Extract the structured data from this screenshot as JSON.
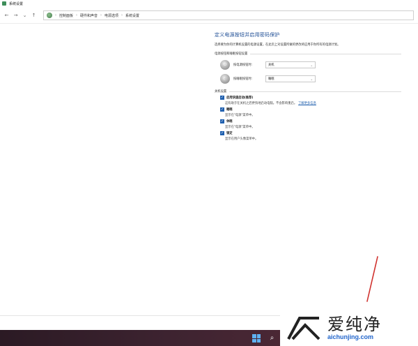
{
  "window": {
    "title": "系统设置"
  },
  "nav": {
    "back_icon": "←",
    "forward_icon": "→",
    "recent_icon": "⌄",
    "up_icon": "↑"
  },
  "breadcrumb": [
    "控制面板",
    "硬件和声音",
    "电源选项",
    "系统设置"
  ],
  "page": {
    "title": "定义电源按钮并启用密码保护",
    "description": "选择要为你的计算机设置的电源设置。在此页上对设置所做的更改将应用于你所有的电源计划。",
    "section_power_buttons": "电源按钮和睡眠按钮设置",
    "power_button": {
      "label": "按电源按钮时:",
      "value": "关机"
    },
    "sleep_button": {
      "label": "按睡眠按钮时:",
      "value": "睡眠"
    },
    "section_shutdown": "关机设置",
    "options": [
      {
        "name": "启用快速启动(推荐)",
        "desc": "这有助于在关机之后更快地启动电脑。不会影响重启。",
        "link": "了解更多信息",
        "checked": true
      },
      {
        "name": "睡眠",
        "desc": "显示在\"电源\"菜单中。",
        "checked": true
      },
      {
        "name": "休眠",
        "desc": "显示在\"电源\"菜单中。",
        "checked": true
      },
      {
        "name": "锁定",
        "desc": "显示在用户头像菜单中。",
        "checked": true
      }
    ]
  },
  "watermark": {
    "text": "爱纯净",
    "url": "aichunjing.com"
  },
  "colors": {
    "accent": "#1f5fae",
    "title_blue": "#1f4e95",
    "annotation_red": "#d0312d"
  }
}
